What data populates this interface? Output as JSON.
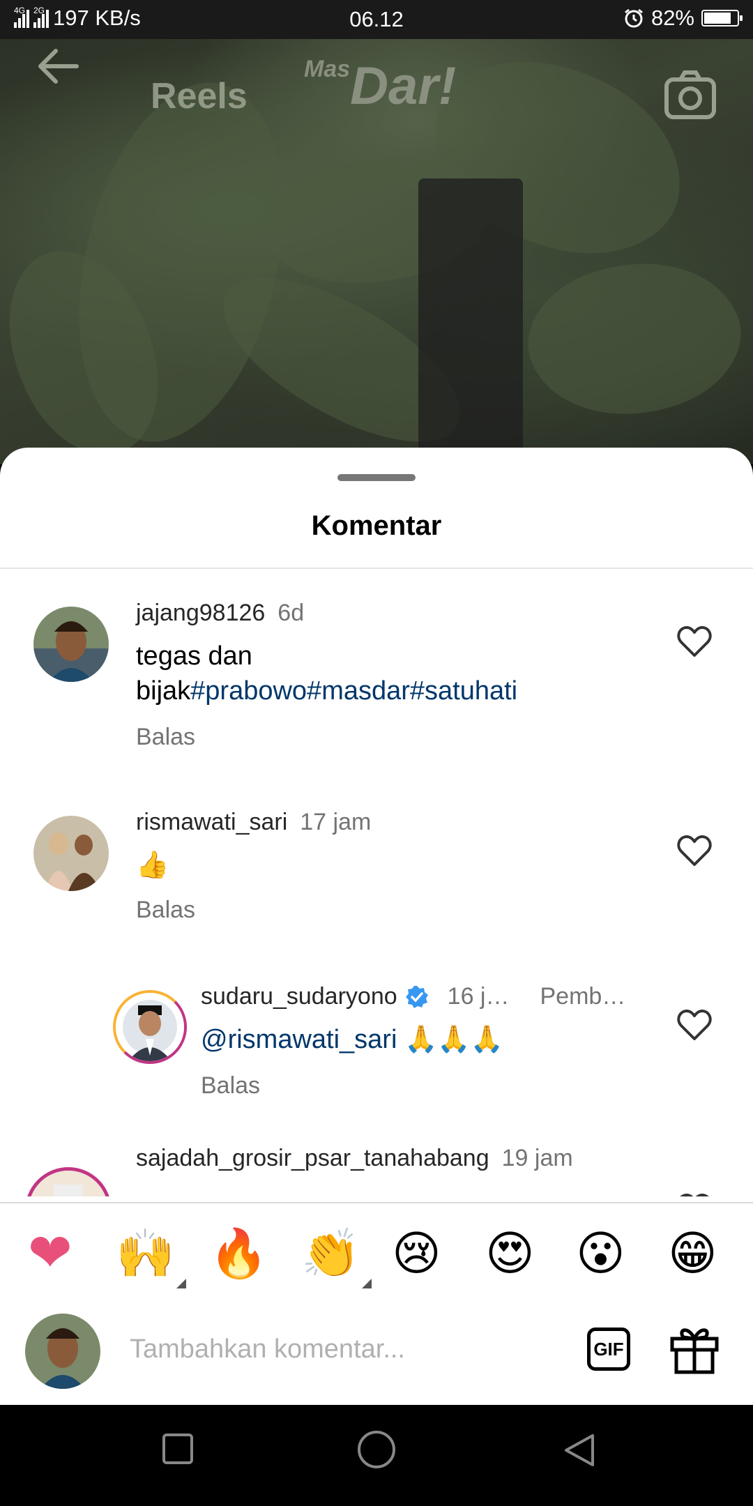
{
  "status_bar": {
    "network_1": "4G",
    "network_2": "2G",
    "speed": "197 KB/s",
    "time": "06.12",
    "battery": "82%",
    "battery_level": 0.82
  },
  "reel_header": {
    "title": "Reels",
    "watermark": "Dar!",
    "watermark_prefix": "Mas"
  },
  "sheet": {
    "title": "Komentar"
  },
  "comments": [
    {
      "username": "jajang98126",
      "time": "6d",
      "text_plain": "tegas dan bijak",
      "hashtags": "#prabowo#masdar#satuhati",
      "reply_label": "Balas"
    },
    {
      "username": "rismawati_sari",
      "time": "17 jam",
      "text_emoji": "👍",
      "reply_label": "Balas"
    },
    {
      "username": "sudaru_sudaryono",
      "time": "16 j…",
      "badge": "Pemb…",
      "mention": "@rismawati_sari",
      "text_emoji": "🙏🙏🙏",
      "reply_label": "Balas"
    },
    {
      "username": "sajadah_grosir_psar_tanahabang",
      "time": "19 jam"
    }
  ],
  "reactions": [
    "❤",
    "🙌",
    "🔥",
    "👏",
    "😢",
    "😍",
    "😮",
    "😁"
  ],
  "input": {
    "placeholder": "Tambahkan komentar...",
    "gif_label": "GIF"
  },
  "colors": {
    "link": "#00376b",
    "heart_reaction": "#e8507a",
    "story_ring_start": "#f9b233",
    "story_ring_end": "#c13584"
  }
}
